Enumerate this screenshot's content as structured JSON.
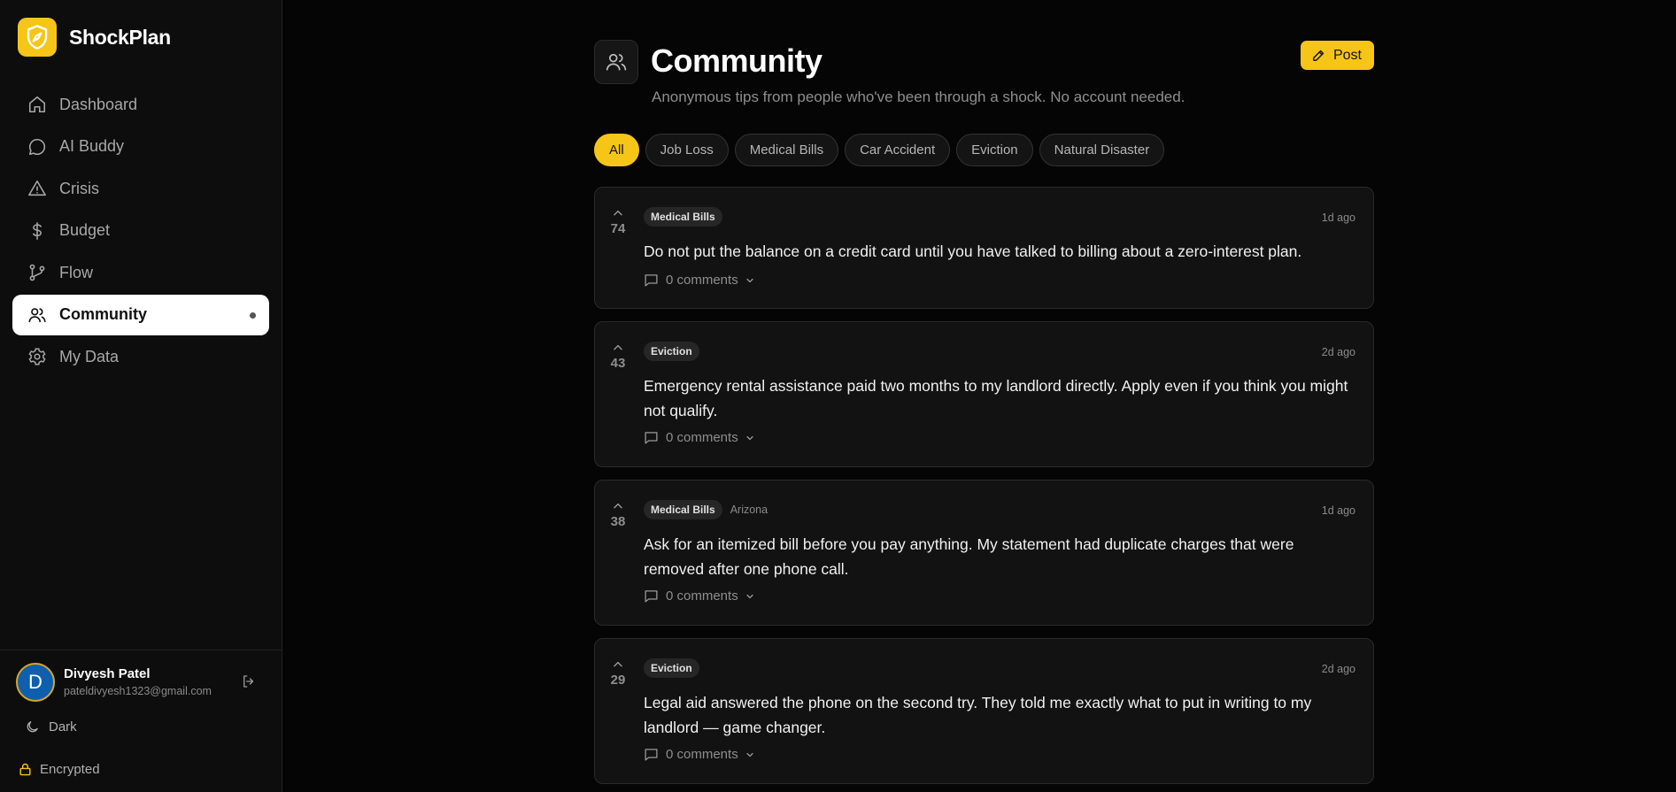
{
  "app": {
    "name": "ShockPlan"
  },
  "colors": {
    "accent": "#f5c518",
    "background": "#050505",
    "sidebar": "#0d0d0d",
    "card": "#121212"
  },
  "sidebar": {
    "items": [
      {
        "label": "Dashboard",
        "icon": "home-icon"
      },
      {
        "label": "AI Buddy",
        "icon": "chat-bubble-icon"
      },
      {
        "label": "Crisis",
        "icon": "warning-triangle-icon"
      },
      {
        "label": "Budget",
        "icon": "dollar-icon"
      },
      {
        "label": "Flow",
        "icon": "git-branch-icon"
      },
      {
        "label": "Community",
        "icon": "users-icon",
        "active": true
      },
      {
        "label": "My Data",
        "icon": "gear-icon"
      }
    ],
    "user": {
      "initial": "D",
      "name": "Divyesh Patel",
      "email": "pateldivyesh1323@gmail.com"
    },
    "theme_label": "Dark",
    "security_label": "Encrypted"
  },
  "main": {
    "title": "Community",
    "subtitle": "Anonymous tips from people who've been through a shock. No account needed.",
    "post_button": "Post",
    "filters": [
      {
        "label": "All",
        "active": true
      },
      {
        "label": "Job Loss"
      },
      {
        "label": "Medical Bills"
      },
      {
        "label": "Car Accident"
      },
      {
        "label": "Eviction"
      },
      {
        "label": "Natural Disaster"
      }
    ],
    "posts": [
      {
        "votes": "74",
        "tag": "Medical Bills",
        "location": "",
        "time": "1d ago",
        "text": "Do not put the balance on a credit card until you have talked to billing about a zero-interest plan.",
        "comments": "0 comments"
      },
      {
        "votes": "43",
        "tag": "Eviction",
        "location": "",
        "time": "2d ago",
        "text": "Emergency rental assistance paid two months to my landlord directly. Apply even if you think you might not qualify.",
        "comments": "0 comments"
      },
      {
        "votes": "38",
        "tag": "Medical Bills",
        "location": "Arizona",
        "time": "1d ago",
        "text": "Ask for an itemized bill before you pay anything. My statement had duplicate charges that were removed after one phone call.",
        "comments": "0 comments"
      },
      {
        "votes": "29",
        "tag": "Eviction",
        "location": "",
        "time": "2d ago",
        "text": "Legal aid answered the phone on the second try. They told me exactly what to put in writing to my landlord — game changer.",
        "comments": "0 comments"
      }
    ]
  }
}
